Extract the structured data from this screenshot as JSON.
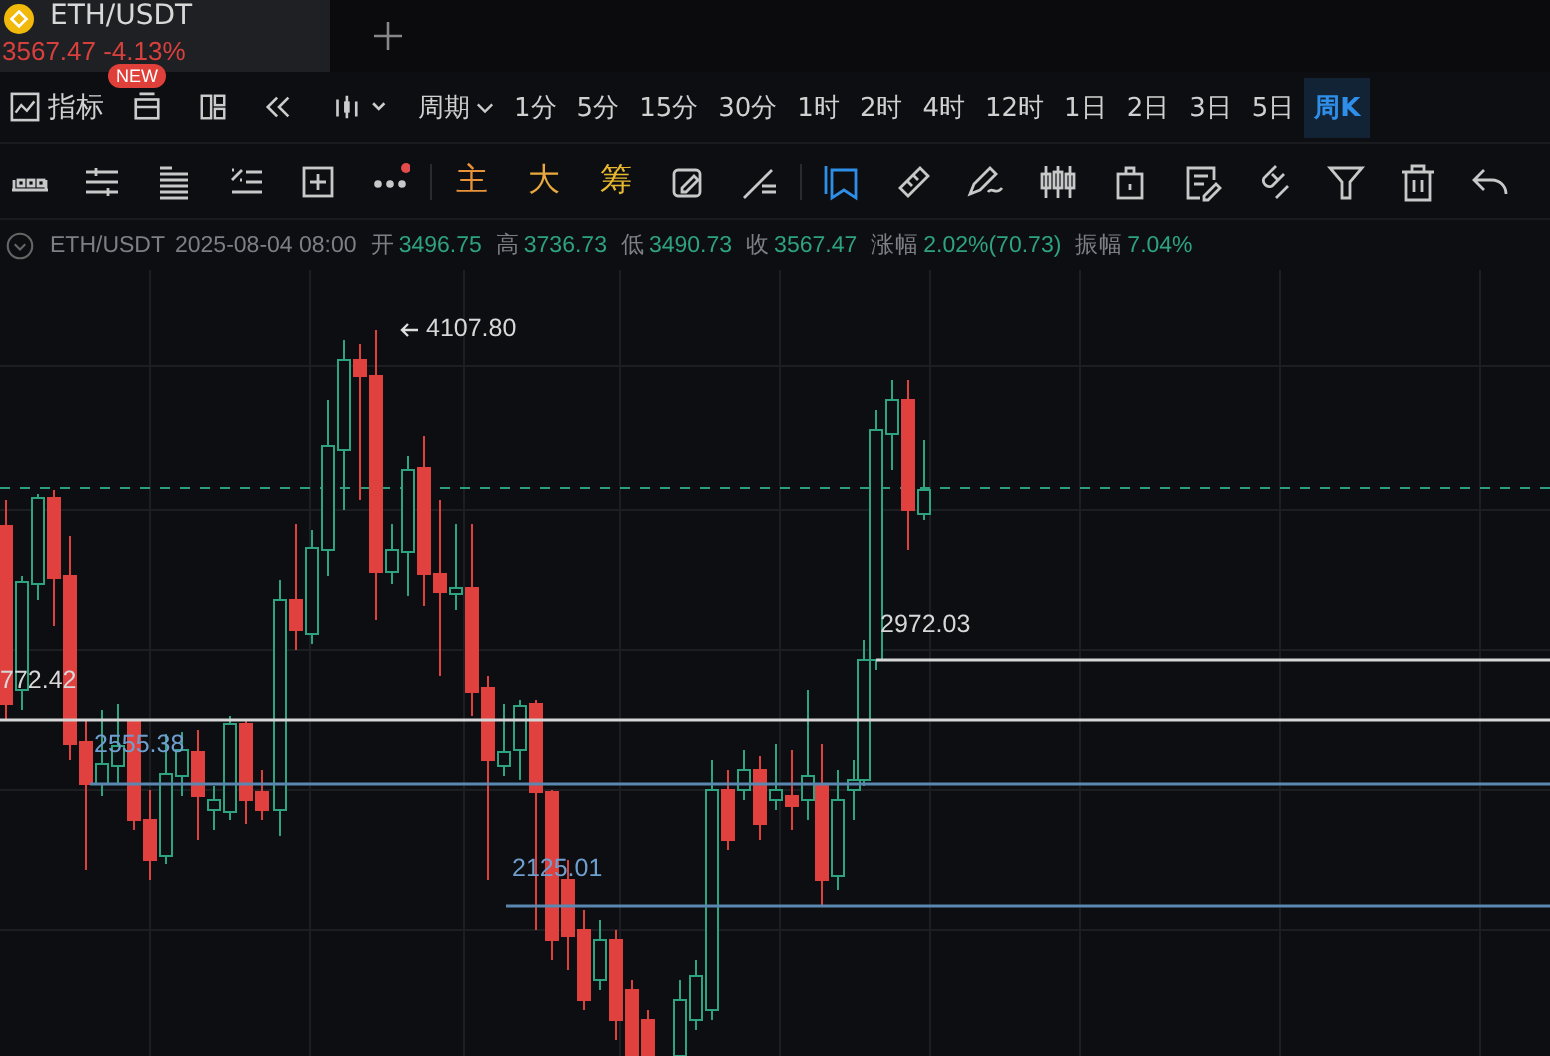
{
  "tab": {
    "symbol": "ETH/USDT",
    "price": "3567.47",
    "change": "-4.13%",
    "badge": "NEW"
  },
  "toolbar": {
    "indicator_label": "指标",
    "period_label": "周期",
    "intervals": [
      {
        "label": "1分",
        "selected": false
      },
      {
        "label": "5分",
        "selected": false
      },
      {
        "label": "15分",
        "selected": false
      },
      {
        "label": "30分",
        "selected": false
      },
      {
        "label": "1时",
        "selected": false
      },
      {
        "label": "2时",
        "selected": false
      },
      {
        "label": "4时",
        "selected": false
      },
      {
        "label": "12时",
        "selected": false
      },
      {
        "label": "1日",
        "selected": false
      },
      {
        "label": "2日",
        "selected": false
      },
      {
        "label": "3日",
        "selected": false
      },
      {
        "label": "5日",
        "selected": false
      },
      {
        "label": "周K",
        "selected": true
      }
    ]
  },
  "tools": [
    {
      "kind": "dots-ruler",
      "selected": false
    },
    {
      "kind": "sliders",
      "selected": false
    },
    {
      "kind": "list",
      "selected": false
    },
    {
      "kind": "percent-list",
      "selected": false
    },
    {
      "kind": "plus-box",
      "selected": false
    },
    {
      "kind": "more",
      "selected": false,
      "alert": true
    },
    {
      "kind": "separator"
    },
    {
      "kind": "text",
      "label": "主",
      "color": "#e8923a"
    },
    {
      "kind": "text",
      "label": "大",
      "color": "#e8a83e"
    },
    {
      "kind": "text",
      "label": "筹",
      "color": "#e8b830"
    },
    {
      "kind": "edit-box",
      "selected": false
    },
    {
      "kind": "line-tool",
      "selected": false
    },
    {
      "kind": "separator"
    },
    {
      "kind": "bookmark",
      "selected": true
    },
    {
      "kind": "ruler",
      "selected": false
    },
    {
      "kind": "pen",
      "selected": false
    },
    {
      "kind": "candles",
      "selected": false
    },
    {
      "kind": "lock",
      "selected": false
    },
    {
      "kind": "note",
      "selected": false
    },
    {
      "kind": "magnet",
      "selected": false
    },
    {
      "kind": "filter",
      "selected": false
    },
    {
      "kind": "trash",
      "selected": false
    },
    {
      "kind": "undo",
      "selected": false
    }
  ],
  "info": {
    "symbol": "ETH/USDT",
    "time": "2025-08-04 08:00",
    "fields": [
      {
        "label": "开",
        "value": "3496.75"
      },
      {
        "label": "高",
        "value": "3736.73"
      },
      {
        "label": "低",
        "value": "3490.73"
      },
      {
        "label": "收",
        "value": "3567.47"
      },
      {
        "label": "涨幅",
        "value": "2.02%(70.73)"
      },
      {
        "label": "振幅",
        "value": "7.04%"
      }
    ]
  },
  "chart": {
    "labels": [
      {
        "kind": "high",
        "text": "4107.80"
      },
      {
        "kind": "white",
        "text": "772.42"
      },
      {
        "kind": "blue",
        "text": "2555.38"
      },
      {
        "kind": "blue",
        "text": "2125.01"
      },
      {
        "kind": "white",
        "text": "2972.03"
      }
    ]
  }
}
